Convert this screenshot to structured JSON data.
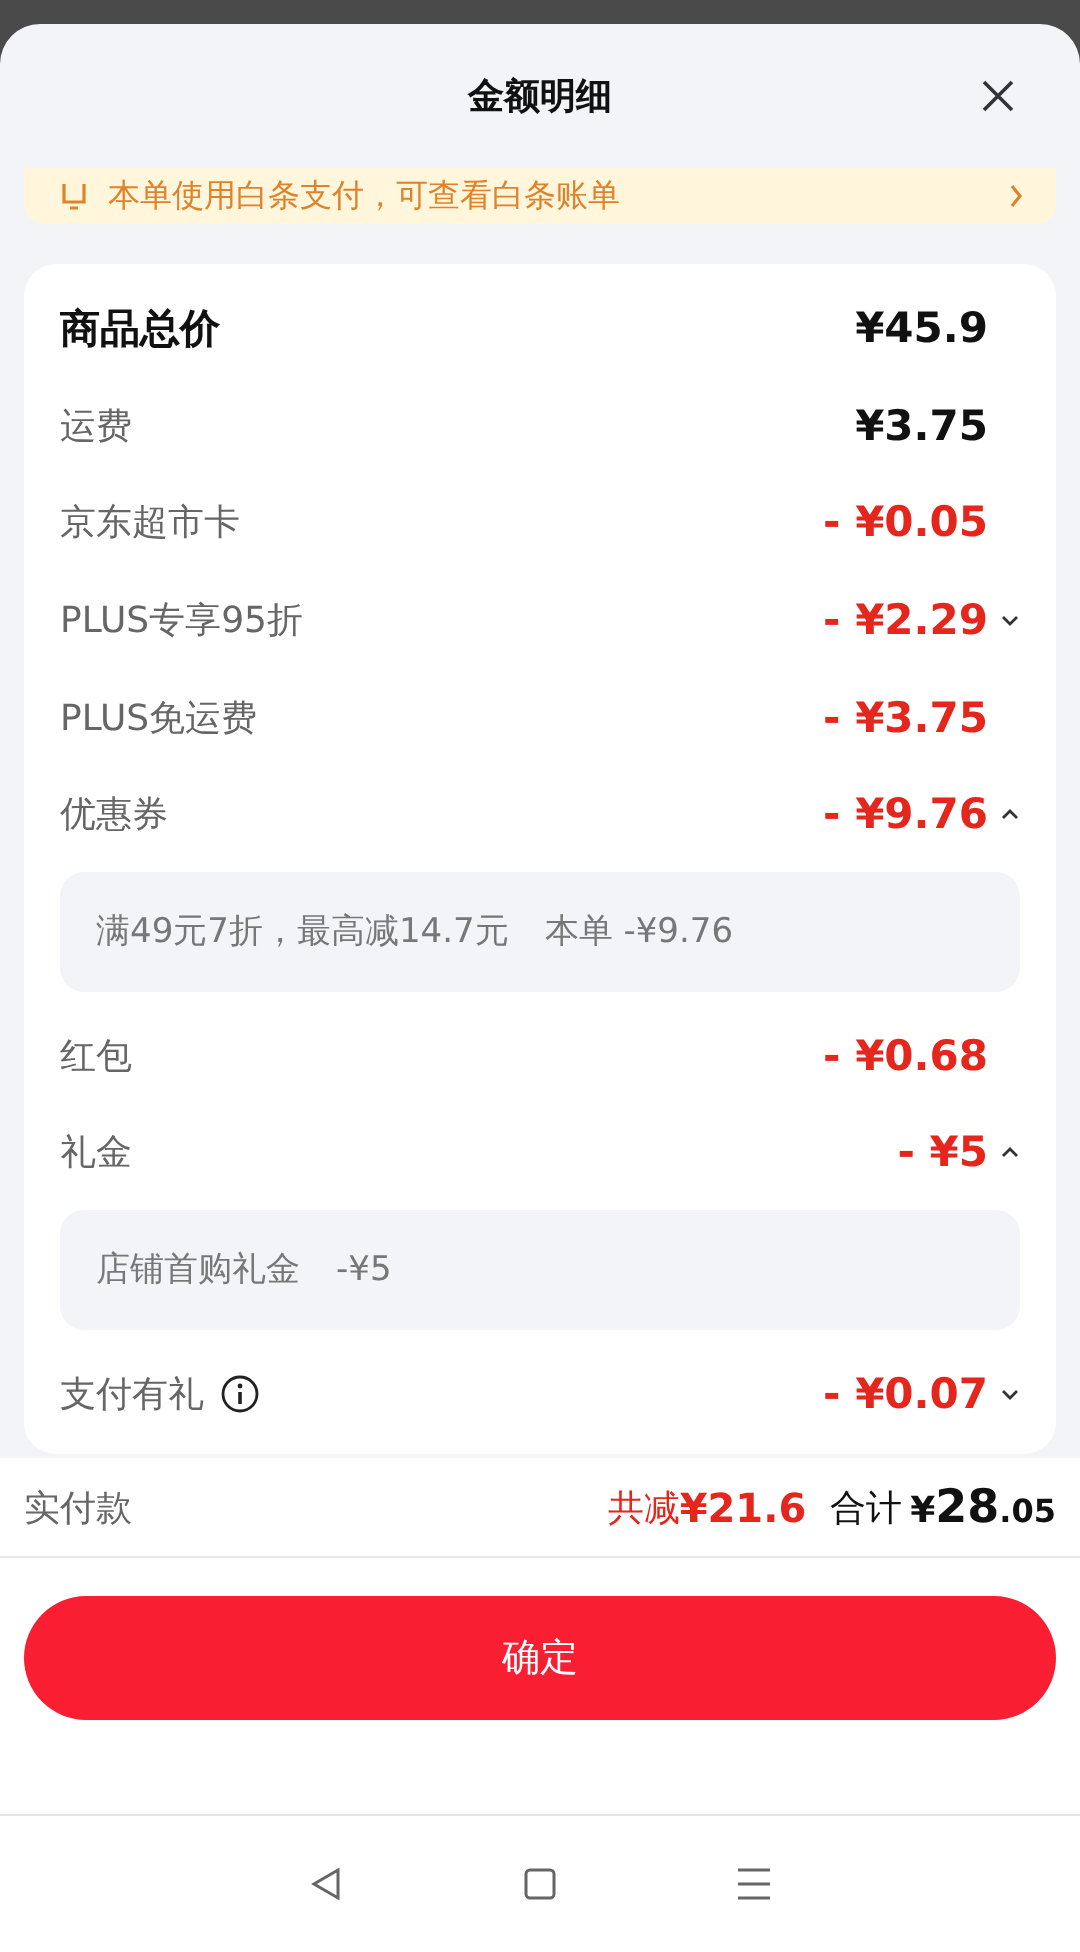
{
  "sheet": {
    "title": "金额明细"
  },
  "banner": {
    "text": "本单使用白条支付，可查看白条账单"
  },
  "rows": [
    {
      "label": "商品总价",
      "amount": "¥45.9",
      "kind": "total"
    },
    {
      "label": "运费",
      "amount": "¥3.75",
      "kind": "fee"
    },
    {
      "label": "京东超市卡",
      "amount": "- ¥0.05",
      "kind": "discount"
    },
    {
      "label": "PLUS专享95折",
      "amount": "- ¥2.29",
      "kind": "discount",
      "expanded": false
    },
    {
      "label": "PLUS免运费",
      "amount": "- ¥3.75",
      "kind": "discount"
    },
    {
      "label": "优惠券",
      "amount": "- ¥9.76",
      "kind": "discount",
      "expanded": true,
      "detail": [
        "满49元7折，最高减14.7元",
        "本单 -¥9.76"
      ]
    },
    {
      "label": "红包",
      "amount": "- ¥0.68",
      "kind": "discount"
    },
    {
      "label": "礼金",
      "amount": "- ¥5",
      "kind": "discount",
      "expanded": true,
      "detail": [
        "店铺首购礼金",
        "-¥5"
      ]
    },
    {
      "label": "支付有礼",
      "amount": "- ¥0.07",
      "kind": "discount",
      "expanded": false,
      "info": true
    }
  ],
  "summary": {
    "label": "实付款",
    "saved": "共减",
    "saved_amount": "¥21.6",
    "total_label": "合计",
    "total_currency": "¥",
    "total_integer": "28",
    "total_decimal": ".05"
  },
  "confirm_button": "确定"
}
